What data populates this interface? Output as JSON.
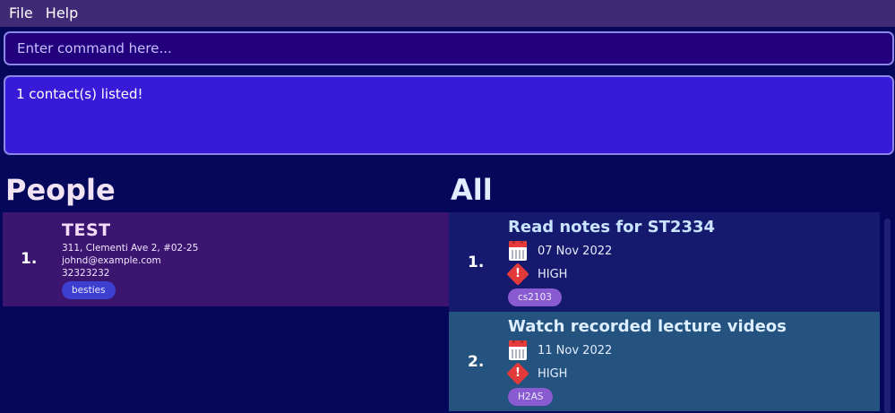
{
  "menu": {
    "file": "File",
    "help": "Help"
  },
  "command": {
    "placeholder": "Enter command here..."
  },
  "result": {
    "text": "1 contact(s) listed!"
  },
  "people": {
    "title": "People",
    "items": [
      {
        "index": "1.",
        "name": "TEST",
        "address": "311, Clementi Ave 2, #02-25",
        "email": "johnd@example.com",
        "phone": "32323232",
        "tag": "besties"
      }
    ]
  },
  "tasks": {
    "title": "All",
    "items": [
      {
        "index": "1.",
        "title": "Read notes for ST2334",
        "date": "07 Nov 2022",
        "priority": "HIGH",
        "tag": "cs2103"
      },
      {
        "index": "2.",
        "title": "Watch recorded lecture videos",
        "date": "11 Nov 2022",
        "priority": "HIGH",
        "tag": "H2AS"
      }
    ]
  },
  "icons": {
    "date": "calendar-icon",
    "priority": "priority-high-icon"
  }
}
